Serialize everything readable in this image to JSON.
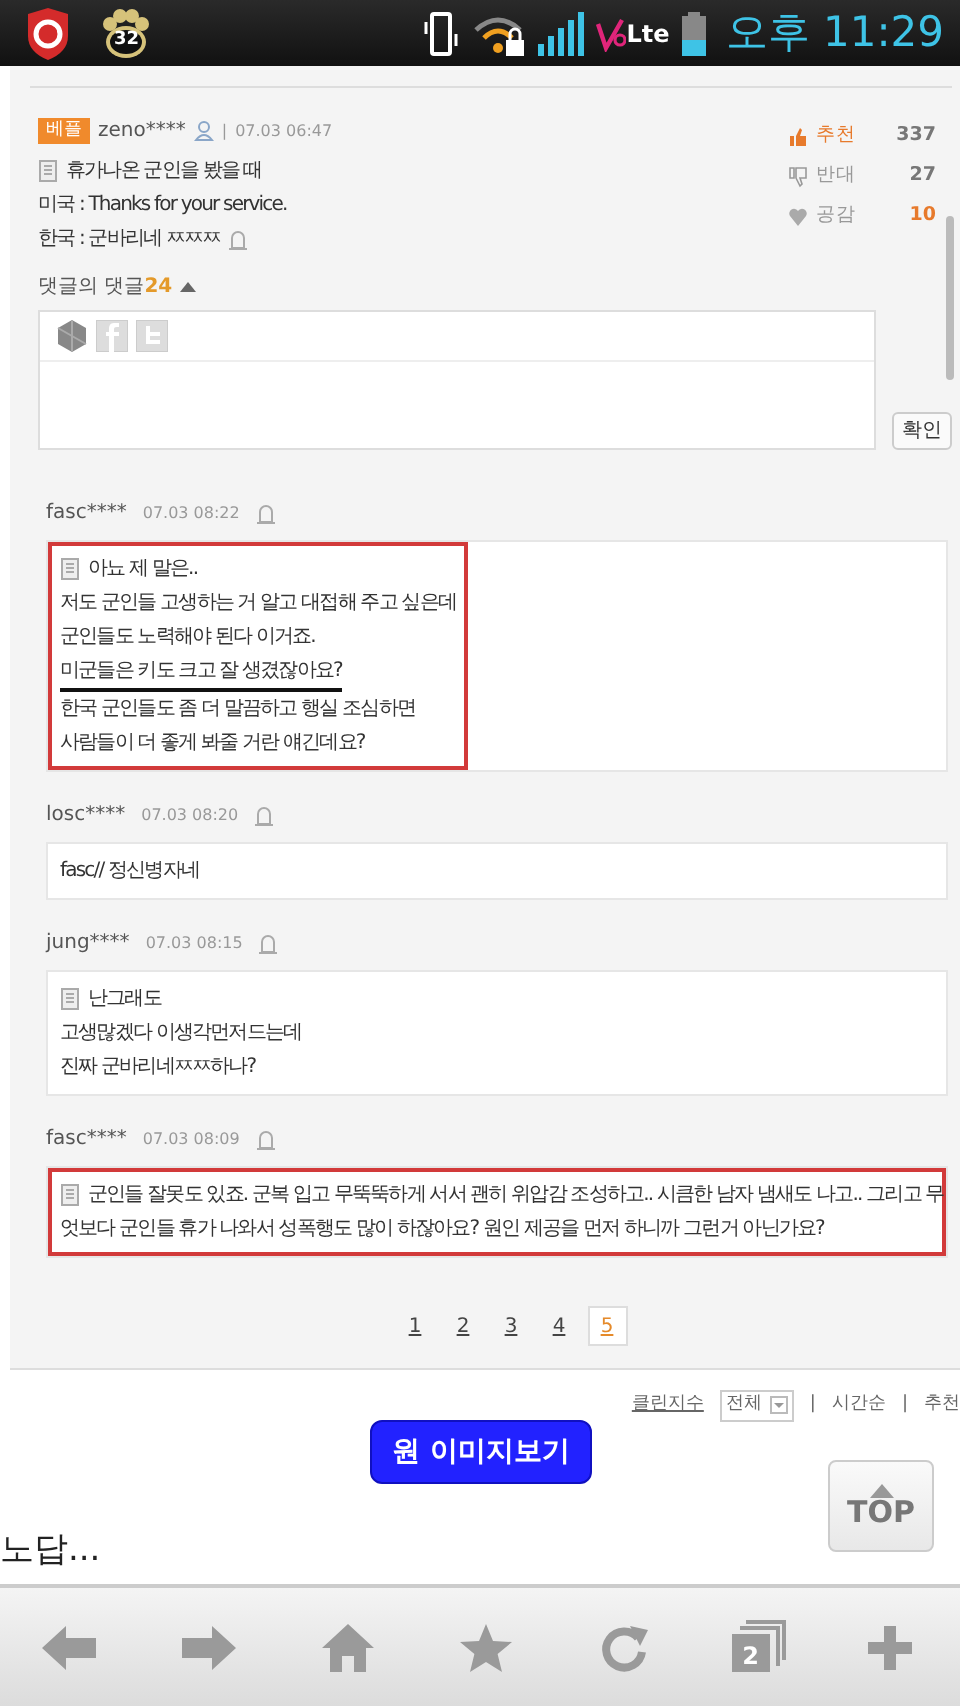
{
  "status_bar": {
    "notification_count": "32",
    "network_label": "Lte",
    "time": "오후 11:29"
  },
  "best_comment": {
    "badge": "베플",
    "user": "zeno****",
    "separator": "|",
    "time": "07.03 06:47",
    "lines": [
      "휴가나온 군인을 봤을 때",
      "미국 : Thanks for your service.",
      "한국 : 군바리네 ㅉㅉㅉ"
    ],
    "votes": [
      {
        "kind": "up",
        "label": "추천",
        "count": "337",
        "highlighted": false
      },
      {
        "kind": "down",
        "label": "반대",
        "count": "27",
        "highlighted": false
      },
      {
        "kind": "heart",
        "label": "공감",
        "count": "10",
        "highlighted": true
      }
    ]
  },
  "replies_toggle": {
    "label": "댓글의 댓글",
    "count": "24",
    "expanded": true
  },
  "reply_form": {
    "confirm_button": "확인"
  },
  "replies": [
    {
      "user": "fasc****",
      "time": "07.03 08:22",
      "highlighted": true,
      "lines": [
        {
          "text": "아뇨 제 말은..",
          "underlined": false
        },
        {
          "text": "저도 군인들 고생하는 거 알고 대접해 주고 싶은데",
          "underlined": false
        },
        {
          "text": "군인들도 노력해야 된다 이거죠.",
          "underlined": false
        },
        {
          "text": "미군들은 키도 크고 잘 생겼잖아요?",
          "underlined": true
        },
        {
          "text": "한국 군인들도 좀 더 말끔하고 행실 조심하면",
          "underlined": false
        },
        {
          "text": "사람들이 더 좋게 봐줄 거란 얘긴데요?",
          "underlined": false
        }
      ]
    },
    {
      "user": "losc****",
      "time": "07.03 08:20",
      "highlighted": false,
      "lines": [
        {
          "text": "fasc// 정신병자네",
          "underlined": false
        }
      ]
    },
    {
      "user": "jung****",
      "time": "07.03 08:15",
      "highlighted": false,
      "lines": [
        {
          "text": "난그래도",
          "underlined": false
        },
        {
          "text": "고생많겠다 이생각먼저드는데",
          "underlined": false
        },
        {
          "text": "진짜 군바리네ㅉㅉ하나?",
          "underlined": false
        }
      ]
    },
    {
      "user": "fasc****",
      "time": "07.03 08:09",
      "highlighted": true,
      "lines": [
        {
          "text": "군인들 잘못도 있죠. 군복 입고 무뚝뚝하게 서서 괜히 위압감 조성하고.. 시큼한 남자 냄새도 나고.. 그리고 무",
          "underlined": false
        },
        {
          "text": "엇보다 군인들 휴가 나와서 성폭행도 많이 하잖아요? 원인 제공을 먼저 하니까 그런거 아닌가요?",
          "underlined": false
        }
      ]
    }
  ],
  "pagination": [
    {
      "label": "1",
      "selected": false
    },
    {
      "label": "2",
      "selected": false
    },
    {
      "label": "3",
      "selected": false
    },
    {
      "label": "4",
      "selected": false
    },
    {
      "label": "5",
      "selected": true
    }
  ],
  "sort_bar": {
    "clean_index": "클린지수",
    "filter": "전체",
    "options": [
      {
        "separator": "|",
        "label": "시간순"
      },
      {
        "separator": "|",
        "label": "추천"
      }
    ]
  },
  "view_original_button": "원 이미지보기",
  "top_button": "TOP",
  "article_snippet": "노답...",
  "browser_toolbar": {
    "tab_count": "2"
  }
}
